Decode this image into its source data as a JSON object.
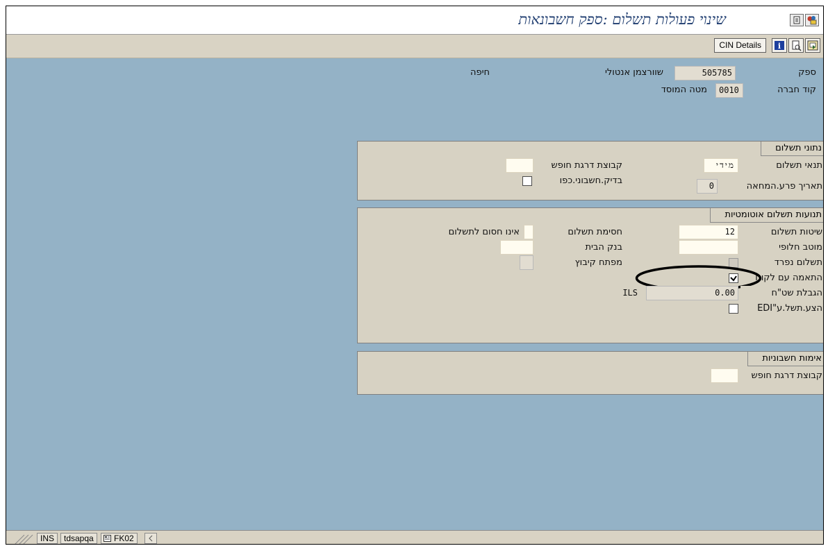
{
  "title": "שינוי פעולות תשלום :ספק חשבונאות",
  "titlebar_buttons": [
    "window-menu-icon",
    "customize-layout-icon"
  ],
  "appbar": {
    "cin_details": "CIN Details",
    "buttons": [
      "info-icon",
      "display-document-icon",
      "export-icon"
    ]
  },
  "header": {
    "vendor_label": "ספק",
    "vendor_value": "505785",
    "vendor_name": "שוורצמן אנטולי",
    "vendor_city": "חיפה",
    "company_label": "קוד חברה",
    "company_value": "0010",
    "company_name": "מטה המוסד"
  },
  "payment_data": {
    "title": "נתוני תשלום",
    "terms_label": "תנאי תשלום",
    "terms_value": "מידי",
    "tolerance_group_label": "קבוצת דרגת חופש",
    "tolerance_group_value": "",
    "double_invoice_label": "בדיק.חשבוני.כפו",
    "double_invoice_checked": false,
    "check_cashing_label": "תאריך פרע.המחאה",
    "check_cashing_value": "0"
  },
  "auto_payment": {
    "title": "תנועות תשלום אוטומטיות",
    "methods_label": "שיטות תשלום",
    "methods_value": "12",
    "block_label": "חסימת תשלום",
    "block_value": "",
    "block_text": "אינו חסום לתשלום",
    "alt_payee_label": "מוטב חלופי",
    "alt_payee_value": "",
    "house_bank_label": "בנק הבית",
    "house_bank_value": "",
    "individual_label": "תשלום נפרד",
    "individual_checked": false,
    "grouping_label": "מפתח קיבוץ",
    "grouping_value": "",
    "clearing_label": "התאמה עם לקוח",
    "clearing_checked": true,
    "bill_limit_label": "הגבלת שט\"ח",
    "bill_limit_value": "0.00",
    "bill_limit_currency": "ILS",
    "edi_label": "הצע.תשל.ע\"EDI",
    "edi_checked": false
  },
  "invoice_verification": {
    "title": "אימות חשבוניות",
    "tolerance_label": "קבוצת דרגת חופש",
    "tolerance_value": ""
  },
  "statusbar": {
    "mode": "INS",
    "server": "tdsapqa",
    "transaction": "FK02"
  }
}
